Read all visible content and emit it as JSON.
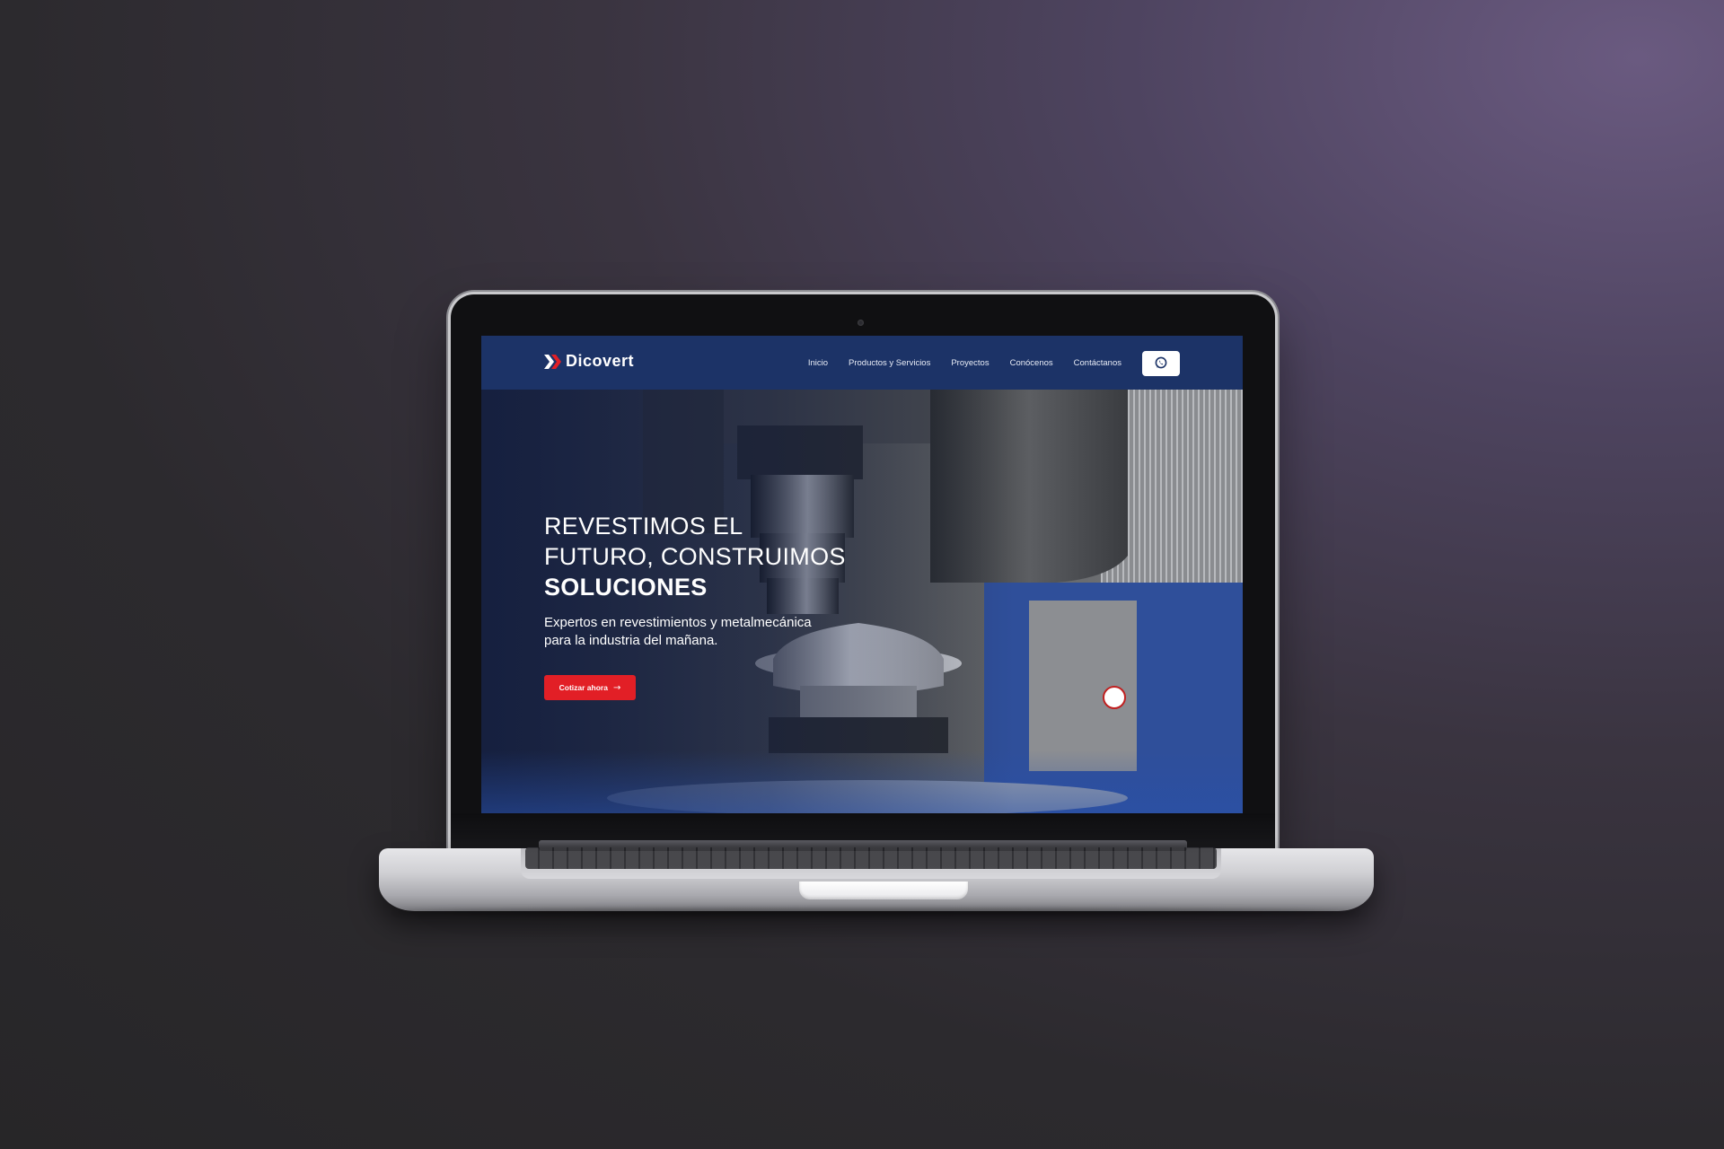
{
  "site": {
    "brand": "Dicovert",
    "colors": {
      "nav_bg": "#1c3367",
      "accent": "#e21f26",
      "text": "#ffffff",
      "backdrop": "#2c2a2e"
    }
  },
  "nav": {
    "items": [
      {
        "label": "Inicio"
      },
      {
        "label": "Productos y Servicios"
      },
      {
        "label": "Proyectos"
      },
      {
        "label": "Conócenos"
      },
      {
        "label": "Contáctanos"
      }
    ],
    "whatsapp_icon": "whatsapp-icon"
  },
  "hero": {
    "title_line1": "REVESTIMOS EL",
    "title_line2": "FUTURO, CONSTRUIMOS",
    "title_line3": "SOLUCIONES",
    "subtitle_line1": "Expertos en revestimientos y metalmecánica",
    "subtitle_line2": "para la industria del mañana.",
    "cta_label": "Cotizar ahora",
    "cta_icon": "arrow-right-icon",
    "background_image": "cnc-machine-turbine"
  }
}
